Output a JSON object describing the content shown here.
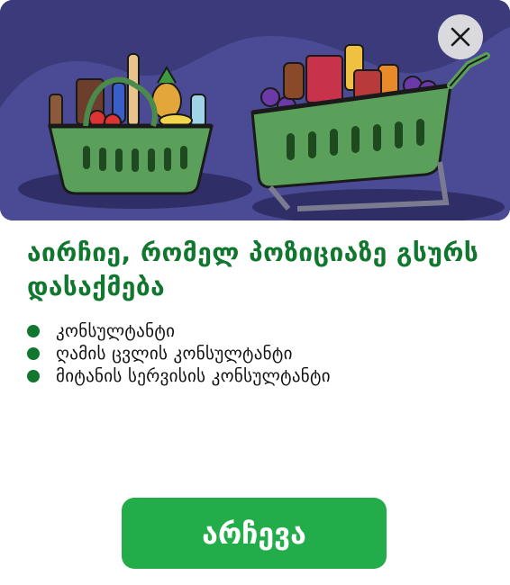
{
  "modal": {
    "title": "აირჩიე, რომელ პოზიციაზე გსურს დასაქმება",
    "options": [
      {
        "label": "კონსულტანტი"
      },
      {
        "label": "ღამის ცვლის კონსულტანტი"
      },
      {
        "label": "მიტანის სერვისის კონსულტანტი"
      }
    ],
    "choose_button_label": "არჩევა",
    "close_icon": "close-icon",
    "hero_illustration": "grocery-baskets-illustration"
  },
  "colors": {
    "accent_green": "#11772e",
    "button_green": "#22ad4a",
    "hero_background": "#3b3a7a",
    "close_button_bg": "#d9d9de"
  }
}
